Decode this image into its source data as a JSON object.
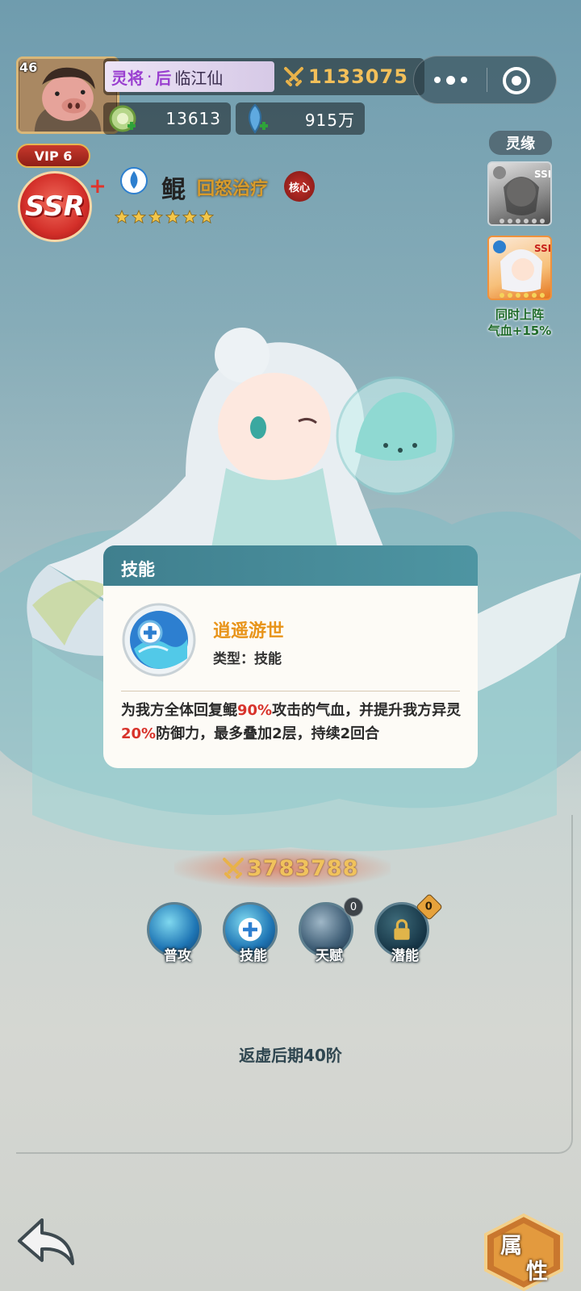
{
  "player": {
    "level": "46",
    "rank_title": "灵将",
    "rank_sep": "·",
    "rank_sub": "后",
    "name": "临江仙",
    "power": "1133075",
    "resource1": "13613",
    "resource2": "915万",
    "vip": "VIP 6"
  },
  "hero": {
    "rarity": "SSR",
    "rarity_plus": "+",
    "name": "鲲",
    "role": "回怒治疗",
    "core_tag": "核心",
    "stars": 6,
    "power": "3783788",
    "realm": "返虚后期40阶"
  },
  "bond": {
    "label": "灵缘",
    "card1_rarity": "SSR",
    "card2_rarity": "SSR",
    "note_line1": "同时上阵",
    "note_line2": "气血+15%"
  },
  "popup": {
    "header": "技能",
    "skill_name": "逍遥游世",
    "skill_type": "类型：技能",
    "desc_part1": "为我方全体回复鲲",
    "desc_hl1": "90%",
    "desc_part2": "攻击的气血，并提升我方异灵",
    "desc_hl2": "20%",
    "desc_part3": "防御力，最多叠加2层，持续2回合"
  },
  "skills": [
    {
      "label": "普攻",
      "count": ""
    },
    {
      "label": "技能",
      "count": ""
    },
    {
      "label": "天赋",
      "count": "0"
    },
    {
      "label": "潜能",
      "count": "0"
    }
  ],
  "buttons": {
    "attr_char1": "属",
    "attr_char2": "性"
  },
  "colors": {
    "accent_gold": "#f0c25c",
    "highlight_red": "#d8332b",
    "skill_name_orange": "#e8941a",
    "popup_header_teal": "#4e95a2"
  }
}
